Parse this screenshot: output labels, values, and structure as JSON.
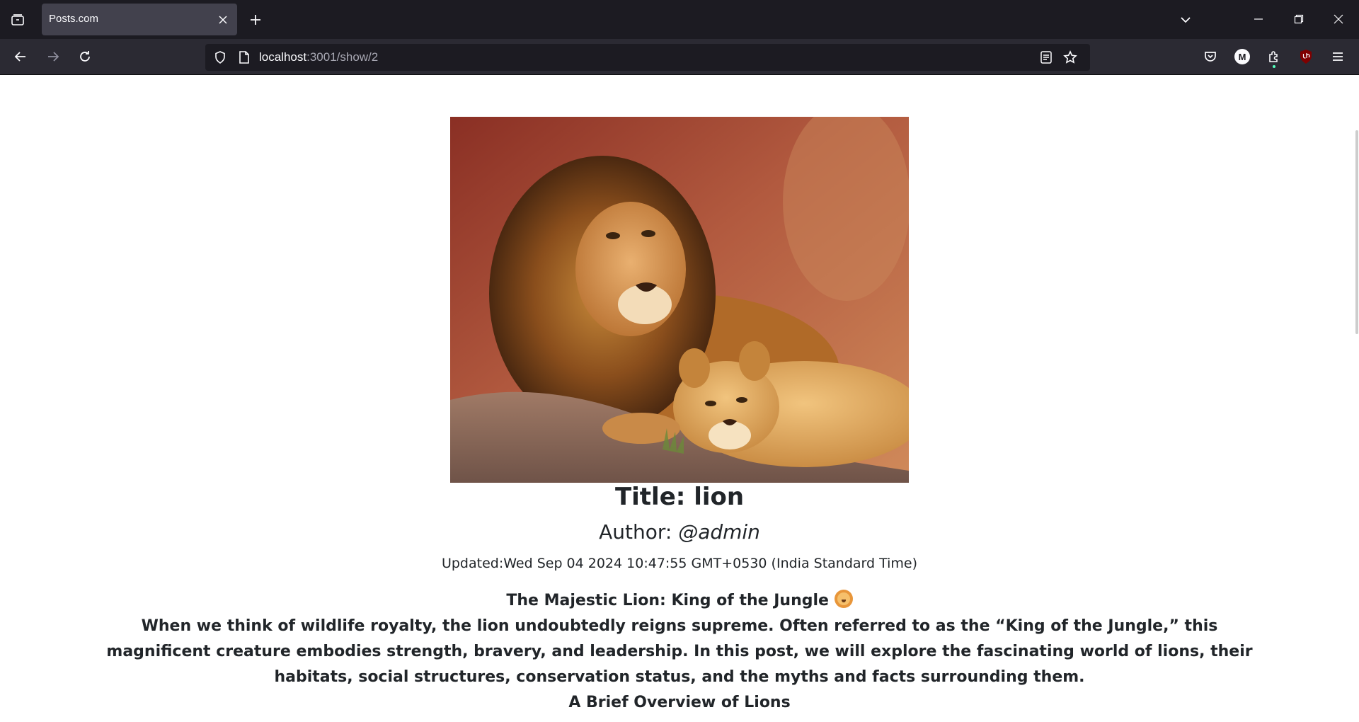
{
  "browser": {
    "tab": {
      "title": "Posts.com"
    },
    "url": {
      "host": "localhost",
      "rest": ":3001/show/2"
    },
    "toolbar_icons": [
      "list-all-tabs-icon",
      "close-icon",
      "plus-icon",
      "chevron-down-icon",
      "minimize-icon",
      "restore-icon",
      "close-icon",
      "back-arrow-icon",
      "forward-arrow-icon",
      "reload-icon",
      "shield-icon",
      "page-icon",
      "reader-view-icon",
      "star-icon",
      "pocket-icon",
      "account-icon",
      "extensions-icon",
      "ublock-icon",
      "hamburger-menu-icon"
    ],
    "account_initial": "M"
  },
  "post": {
    "image": {
      "subject": "lion-and-lioness-photo"
    },
    "title_prefix": "Title: ",
    "title": "lion",
    "author_prefix": "Author: ",
    "author": "@admin",
    "updated": "Updated:Wed Sep 04 2024 10:47:55 GMT+0530 (India Standard Time)",
    "body": {
      "heading": "The Majestic Lion: King of the Jungle",
      "intro": "When we think of wildlife royalty, the lion undoubtedly reigns supreme. Often referred to as the “King of the Jungle,” this magnificent creature embodies strength, bravery, and leadership. In this post, we will explore the fascinating world of lions, their habitats, social structures, conservation status, and the myths and facts surrounding them.",
      "subheading": "A Brief Overview of Lions"
    }
  },
  "colors": {
    "tabstrip_bg": "#1c1b22",
    "navbar_bg": "#2b2a33",
    "active_tab_bg": "#42414d",
    "text_dark": "#212529"
  }
}
